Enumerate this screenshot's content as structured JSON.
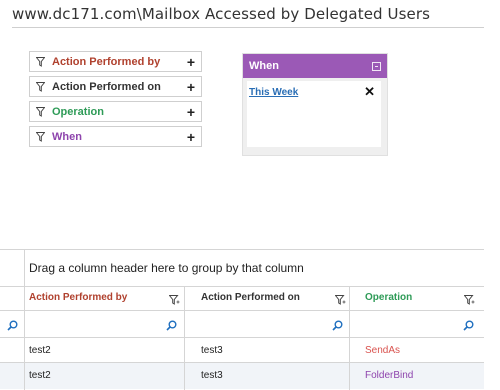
{
  "page": {
    "title": "www.dc171.com\\Mailbox Accessed by Delegated Users"
  },
  "filters": [
    {
      "label": "Action Performed by",
      "color": "#b0412e"
    },
    {
      "label": "Action Performed on",
      "color": "#333333"
    },
    {
      "label": "Operation",
      "color": "#2e9b57"
    },
    {
      "label": "When",
      "color": "#8e44ad"
    }
  ],
  "when_panel": {
    "title": "When",
    "chip": "This Week",
    "header_color": "#9b59b6"
  },
  "grid": {
    "group_hint": "Drag a column header here to group by that column",
    "columns": [
      {
        "label": "Action Performed by",
        "color": "#b0412e"
      },
      {
        "label": "Action Performed on",
        "color": "#333333"
      },
      {
        "label": "Operation",
        "color": "#2e9b57"
      }
    ],
    "rows": [
      {
        "by": "test2",
        "on": "test3",
        "operation": "SendAs",
        "op_color": "#d9534f"
      },
      {
        "by": "test2",
        "on": "test3",
        "operation": "FolderBind",
        "op_color": "#8e44ad"
      }
    ]
  }
}
